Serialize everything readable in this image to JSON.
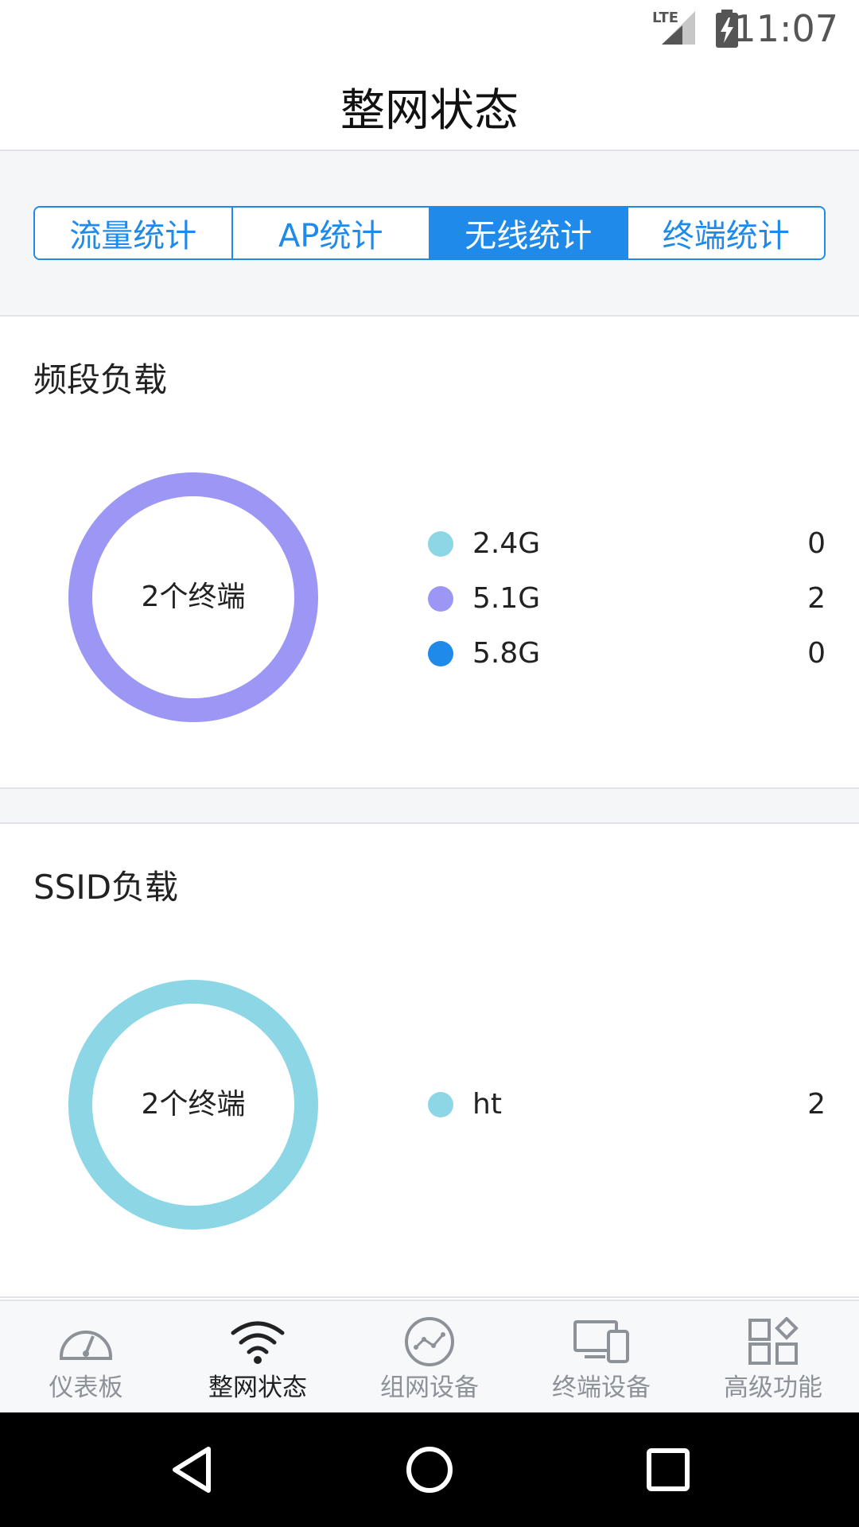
{
  "status_bar": {
    "time": "11:07",
    "network": "LTE"
  },
  "header": {
    "title": "整网状态"
  },
  "tabs": [
    {
      "label": "流量统计",
      "active": false
    },
    {
      "label": "AP统计",
      "active": false
    },
    {
      "label": "无线统计",
      "active": true
    },
    {
      "label": "终端统计",
      "active": false
    }
  ],
  "band_load": {
    "title": "频段负载",
    "center_label": "2个终端",
    "legend": [
      {
        "label": "2.4G",
        "value": "0",
        "color": "#8dd6e6"
      },
      {
        "label": "5.1G",
        "value": "2",
        "color": "#9c97f4"
      },
      {
        "label": "5.8G",
        "value": "0",
        "color": "#1f8ae9"
      }
    ]
  },
  "ssid_load": {
    "title": "SSID负载",
    "center_label": "2个终端",
    "legend": [
      {
        "label": "ht",
        "value": "2",
        "color": "#8dd6e6"
      }
    ]
  },
  "bottom_nav": [
    {
      "label": "仪表板",
      "icon": "speedometer-icon",
      "active": false
    },
    {
      "label": "整网状态",
      "icon": "wifi-icon",
      "active": true
    },
    {
      "label": "组网设备",
      "icon": "network-graph-icon",
      "active": false
    },
    {
      "label": "终端设备",
      "icon": "devices-icon",
      "active": false
    },
    {
      "label": "高级功能",
      "icon": "apps-grid-icon",
      "active": false
    }
  ],
  "colors": {
    "accent": "#1f8ae9",
    "ring_band": "#9c97f4",
    "ring_ssid": "#8dd6e6",
    "nav_inactive": "#8d9299"
  }
}
